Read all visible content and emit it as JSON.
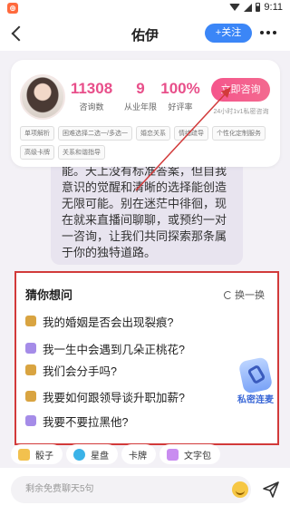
{
  "status": {
    "time": "9:11",
    "app_badge": "⊕"
  },
  "header": {
    "title": "佑伊",
    "follow_label": "+关注"
  },
  "profile": {
    "stats": [
      {
        "value": "11308",
        "label": "咨询数"
      },
      {
        "value": "9",
        "label": "从业年限"
      },
      {
        "value": "100%",
        "label": "好评率"
      }
    ],
    "consult_label": "立即咨询",
    "consult_sub": "24小时1v1私密咨询",
    "tags": [
      "单项解析",
      "困难选择二选一/多选一",
      "婚恋关系",
      "情绪疏导",
      "个性化定制服务",
      "高级卡牌",
      "关系和谐指导"
    ]
  },
  "bubble": {
    "text": "能。天上没有标准答案，但自我意识的觉醒和清晰的选择能创造无限可能。别在迷茫中徘徊，现在就来直播间聊聊，或预约一对一咨询，让我们共同探索那条属于你的独特道路。"
  },
  "guess": {
    "title": "猜你想问",
    "refresh_label": "换一换",
    "questions": [
      {
        "text": "我的婚姻是否会出现裂痕?",
        "icon": "gold"
      },
      {
        "text": "我一生中会遇到几朵正桃花?",
        "icon": "purple"
      },
      {
        "text": "我们会分手吗?",
        "icon": "gold"
      },
      {
        "text": "我要如何跟领导谈升职加薪?",
        "icon": "gold"
      },
      {
        "text": "我要不要拉黑他?",
        "icon": "purple"
      }
    ],
    "secret_label": "私密连麦"
  },
  "tools": [
    {
      "label": "骰子",
      "icon": "dice"
    },
    {
      "label": "星盘",
      "icon": "star"
    },
    {
      "label": "卡牌",
      "icon": "card"
    },
    {
      "label": "文字包",
      "icon": "doc"
    }
  ],
  "input": {
    "placeholder": "剩余免费聊天5句"
  }
}
